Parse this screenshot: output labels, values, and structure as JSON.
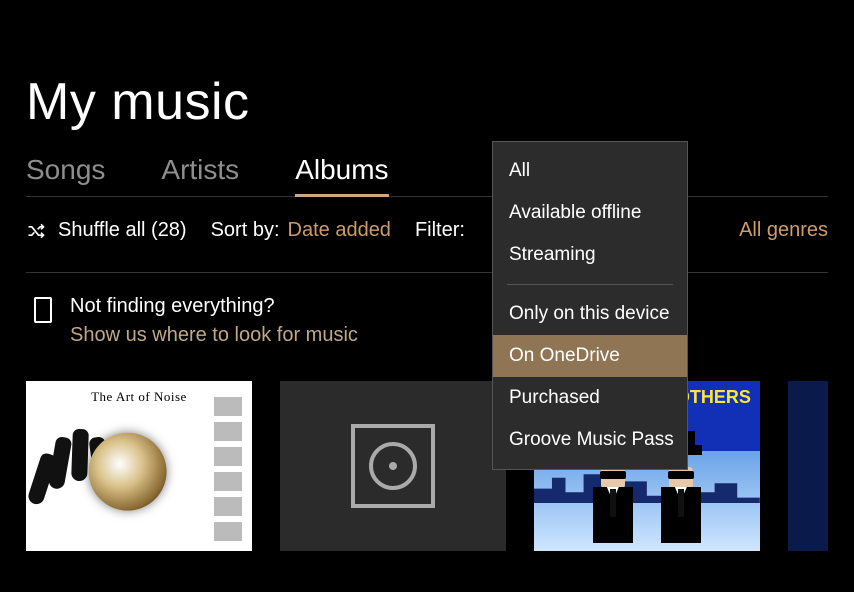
{
  "header": {
    "title": "My music"
  },
  "tabs": [
    {
      "label": "Songs",
      "active": false
    },
    {
      "label": "Artists",
      "active": false
    },
    {
      "label": "Albums",
      "active": true
    }
  ],
  "toolbar": {
    "shuffle_label": "Shuffle all (28)",
    "sort_label": "Sort by:",
    "sort_value": "Date added",
    "filter_label": "Filter:",
    "genres_value": "All genres"
  },
  "tip": {
    "heading": "Not finding everything?",
    "link": "Show us where to look for music"
  },
  "filter_menu": {
    "group1": [
      "All",
      "Available offline",
      "Streaming"
    ],
    "group2": [
      "Only on this device",
      "On OneDrive",
      "Purchased",
      "Groove Music Pass"
    ],
    "selected": "On OneDrive"
  },
  "albums": [
    {
      "cover_text": "The Art of Noise"
    },
    {
      "cover_text": ""
    },
    {
      "cover_text": "THE BLUES BROTHERS"
    },
    {
      "cover_text": ""
    }
  ]
}
